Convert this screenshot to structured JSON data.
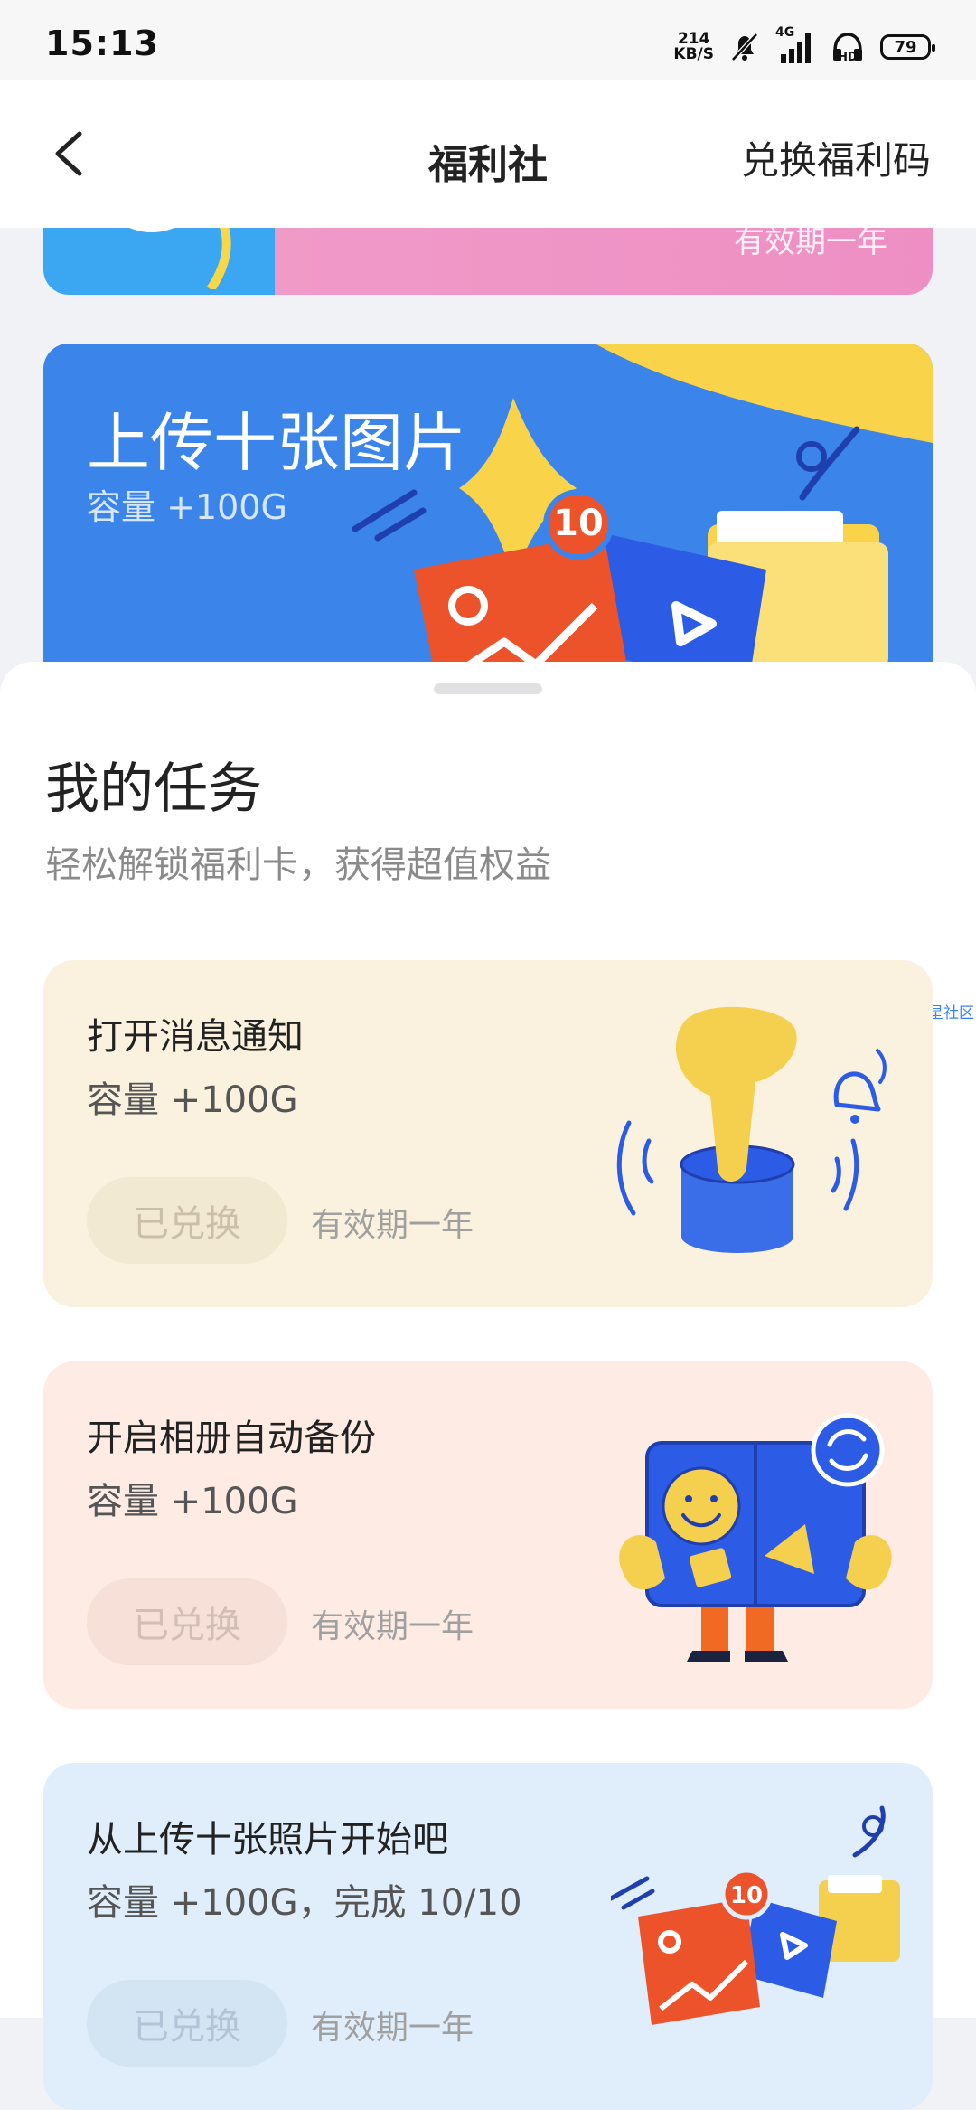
{
  "status_bar": {
    "time": "15:13",
    "speed": "214",
    "speed_unit": "KB/S",
    "network": "4G",
    "battery": "79"
  },
  "nav": {
    "title": "福利社",
    "redeem": "兑换福利码"
  },
  "top_banner": {
    "validity": "有效期一年"
  },
  "upload_banner": {
    "title": "上传十张图片",
    "reward": "容量 +100G",
    "badge": "10"
  },
  "tasks_section": {
    "title": "我的任务",
    "subtitle": "轻松解锁福利卡，获得超值权益",
    "side_link": "流星社区"
  },
  "tasks": [
    {
      "name": "打开消息通知",
      "reward": "容量 +100G",
      "button": "已兑换",
      "validity": "有效期一年",
      "bg": "#faf2de",
      "btn_bg": "#f2e9d3",
      "btn_fg": "#cbbfa8"
    },
    {
      "name": "开启相册自动备份",
      "reward": "容量 +100G",
      "button": "已兑换",
      "validity": "有效期一年",
      "bg": "#fdebe4",
      "btn_bg": "#f6e0d8",
      "btn_fg": "#d2beb5"
    },
    {
      "name": "从上传十张照片开始吧",
      "reward": "容量 +100G，完成 10/10",
      "button": "已兑换",
      "validity": "有效期一年",
      "badge": "10",
      "bg": "#e0eefb",
      "btn_bg": "#d3e4f3",
      "btn_fg": "#b2c4d6"
    }
  ]
}
